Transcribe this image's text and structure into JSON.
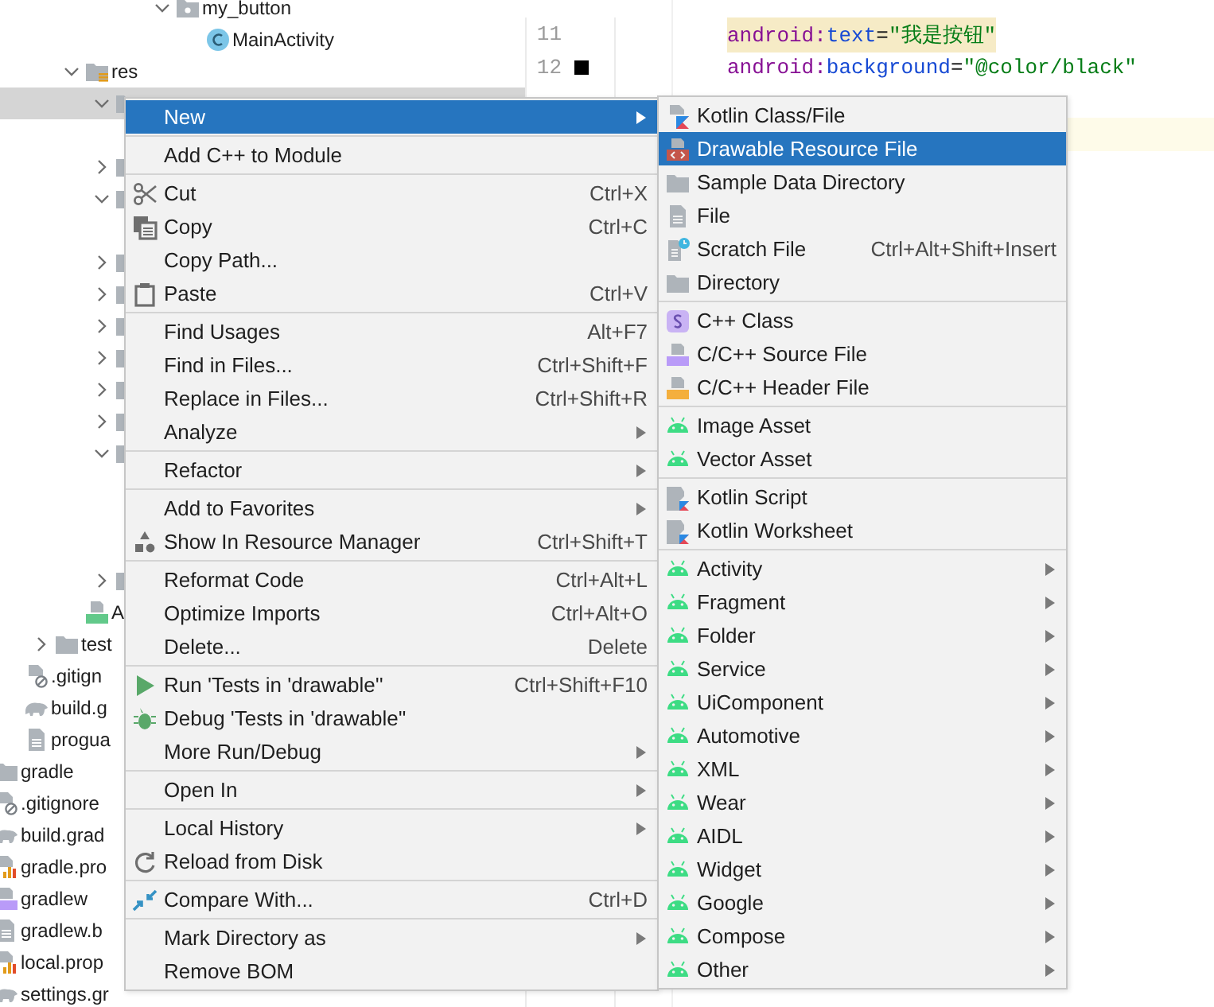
{
  "project_tree": [
    {
      "children": [
        {
          "children": [
            {
              "children": [
                {
                  "children": [
                    {
                      "children": [
                        {
                          "children": [
                            {
                              "label": "my_button",
                              "kind": "package",
                              "expanded": true,
                              "selected": false,
                              "children": [
                                {
                                  "label": "MainActivity",
                                  "kind": "class",
                                  "selected": false
                                }
                              ]
                            }
                          ]
                        }
                      ]
                    }
                  ]
                },
                {
                  "label": "res",
                  "kind": "res-folder",
                  "expanded": true,
                  "selected": false,
                  "children": [
                    {
                      "kind": "folder",
                      "expanded": true,
                      "selected": true,
                      "children": [
                        {
                          "selected": false
                        }
                      ]
                    },
                    {
                      "kind": "folder",
                      "expanded": false,
                      "selected": false
                    },
                    {
                      "kind": "folder",
                      "expanded": true,
                      "selected": false,
                      "children": [
                        {
                          "selected": false
                        }
                      ]
                    },
                    {
                      "kind": "folder",
                      "expanded": false,
                      "selected": false
                    },
                    {
                      "kind": "folder",
                      "expanded": false,
                      "selected": false
                    },
                    {
                      "kind": "folder",
                      "expanded": false,
                      "selected": false
                    },
                    {
                      "kind": "folder",
                      "expanded": false,
                      "selected": false
                    },
                    {
                      "kind": "folder",
                      "expanded": false,
                      "selected": false
                    },
                    {
                      "kind": "folder",
                      "expanded": false,
                      "selected": false
                    },
                    {
                      "kind": "folder",
                      "expanded": true,
                      "selected": false,
                      "children": [
                        {
                          "selected": false
                        },
                        {
                          "selected": false
                        },
                        {
                          "selected": false
                        }
                      ]
                    },
                    {
                      "kind": "folder",
                      "expanded": false,
                      "selected": false
                    }
                  ]
                },
                {
                  "label": "A",
                  "kind": "manifest",
                  "selected": false
                }
              ]
            },
            {
              "label": "test",
              "kind": "folder",
              "expanded": false,
              "selected": false
            }
          ]
        },
        {
          "label": ".gitign",
          "kind": "ignore",
          "selected": false
        },
        {
          "label": "build.g",
          "kind": "gradle",
          "selected": false
        },
        {
          "label": "progua",
          "kind": "text",
          "selected": false
        }
      ]
    },
    {
      "label": "gradle",
      "kind": "folder",
      "selected": false
    },
    {
      "label": ".gitignore",
      "kind": "ignore",
      "selected": false
    },
    {
      "label": "build.grad",
      "kind": "gradle",
      "selected": false
    },
    {
      "label": "gradle.pro",
      "kind": "properties",
      "selected": false
    },
    {
      "label": "gradlew",
      "kind": "script",
      "selected": false
    },
    {
      "label": "gradlew.b",
      "kind": "text",
      "selected": false
    },
    {
      "label": "local.prop",
      "kind": "properties",
      "selected": false
    },
    {
      "label": "settings.gr",
      "kind": "gradle",
      "selected": false
    }
  ],
  "editor": {
    "lines": [
      {
        "number": "11",
        "highlighted": true,
        "current": false,
        "tokens": [
          {
            "text": "android:",
            "kind": "namespace"
          },
          {
            "text": "text",
            "kind": "attribute"
          },
          {
            "text": "=",
            "kind": "plain"
          },
          {
            "text": "\"我是按钮\"",
            "kind": "value"
          }
        ]
      },
      {
        "number": "12",
        "color": "#000000",
        "highlighted": false,
        "current": false,
        "tokens": [
          {
            "text": "android:",
            "kind": "namespace"
          },
          {
            "text": "background",
            "kind": "attribute"
          },
          {
            "text": "=",
            "kind": "plain"
          },
          {
            "text": "\"@color/black\"",
            "kind": "value"
          }
        ]
      },
      {
        "current": false
      },
      {
        "current": true
      }
    ]
  },
  "context_menu": {
    "groups": [
      [
        {
          "label": "New",
          "submenu": true,
          "selected": true
        }
      ],
      [
        {
          "label": "Add C++ to Module",
          "submenu": false,
          "selected": false
        }
      ],
      [
        {
          "label": "Cut",
          "shortcut": "Ctrl+X",
          "kind": "scissors",
          "submenu": false,
          "selected": false
        },
        {
          "label": "Copy",
          "shortcut": "Ctrl+C",
          "kind": "copy",
          "submenu": false,
          "selected": false
        },
        {
          "label": "Copy Path...",
          "submenu": false,
          "selected": false
        },
        {
          "label": "Paste",
          "shortcut": "Ctrl+V",
          "kind": "clipboard",
          "submenu": false,
          "selected": false
        }
      ],
      [
        {
          "label": "Find Usages",
          "shortcut": "Alt+F7",
          "submenu": false,
          "selected": false
        },
        {
          "label": "Find in Files...",
          "shortcut": "Ctrl+Shift+F",
          "submenu": false,
          "selected": false
        },
        {
          "label": "Replace in Files...",
          "shortcut": "Ctrl+Shift+R",
          "submenu": false,
          "selected": false
        },
        {
          "label": "Analyze",
          "submenu": true,
          "selected": false
        }
      ],
      [
        {
          "label": "Refactor",
          "submenu": true,
          "selected": false
        }
      ],
      [
        {
          "label": "Add to Favorites",
          "submenu": true,
          "selected": false
        },
        {
          "label": "Show In Resource Manager",
          "shortcut": "Ctrl+Shift+T",
          "kind": "shapes",
          "submenu": false,
          "selected": false
        }
      ],
      [
        {
          "label": "Reformat Code",
          "shortcut": "Ctrl+Alt+L",
          "submenu": false,
          "selected": false
        },
        {
          "label": "Optimize Imports",
          "shortcut": "Ctrl+Alt+O",
          "submenu": false,
          "selected": false
        },
        {
          "label": "Delete...",
          "shortcut": "Delete",
          "submenu": false,
          "selected": false
        }
      ],
      [
        {
          "label": "Run 'Tests in 'drawable''",
          "shortcut": "Ctrl+Shift+F10",
          "kind": "run",
          "submenu": false,
          "selected": false
        },
        {
          "label": "Debug 'Tests in 'drawable''",
          "kind": "bug",
          "submenu": false,
          "selected": false
        },
        {
          "label": "More Run/Debug",
          "submenu": true,
          "selected": false
        }
      ],
      [
        {
          "label": "Open In",
          "submenu": true,
          "selected": false
        }
      ],
      [
        {
          "label": "Local History",
          "submenu": true,
          "selected": false
        },
        {
          "label": "Reload from Disk",
          "kind": "reload",
          "submenu": false,
          "selected": false
        }
      ],
      [
        {
          "label": "Compare With...",
          "shortcut": "Ctrl+D",
          "kind": "compare",
          "submenu": false,
          "selected": false
        }
      ],
      [
        {
          "label": "Mark Directory as",
          "submenu": true,
          "selected": false
        },
        {
          "label": "Remove BOM",
          "submenu": false,
          "selected": false
        }
      ]
    ]
  },
  "new_submenu": {
    "groups": [
      [
        {
          "label": "Kotlin Class/File",
          "kind": "kotlin-file",
          "submenu": false,
          "selected": false
        },
        {
          "label": "Drawable Resource File",
          "kind": "xml-file",
          "submenu": false,
          "selected": true
        },
        {
          "label": "Sample Data Directory",
          "kind": "folder",
          "submenu": false,
          "selected": false
        },
        {
          "label": "File",
          "kind": "file",
          "submenu": false,
          "selected": false
        },
        {
          "label": "Scratch File",
          "shortcut": "Ctrl+Alt+Shift+Insert",
          "kind": "scratch",
          "submenu": false,
          "selected": false
        },
        {
          "label": "Directory",
          "kind": "folder",
          "submenu": false,
          "selected": false
        }
      ],
      [
        {
          "label": "C++ Class",
          "kind": "cpp-class",
          "submenu": false,
          "selected": false
        },
        {
          "label": "C/C++ Source File",
          "kind": "cpp-source",
          "submenu": false,
          "selected": false
        },
        {
          "label": "C/C++ Header File",
          "kind": "cpp-header",
          "submenu": false,
          "selected": false
        }
      ],
      [
        {
          "label": "Image Asset",
          "kind": "android",
          "submenu": false,
          "selected": false
        },
        {
          "label": "Vector Asset",
          "kind": "android",
          "submenu": false,
          "selected": false
        }
      ],
      [
        {
          "label": "Kotlin Script",
          "kind": "kotlin-script",
          "submenu": false,
          "selected": false
        },
        {
          "label": "Kotlin Worksheet",
          "kind": "kotlin-script",
          "submenu": false,
          "selected": false
        }
      ],
      [
        {
          "label": "Activity",
          "kind": "android",
          "submenu": true,
          "selected": false
        },
        {
          "label": "Fragment",
          "kind": "android",
          "submenu": true,
          "selected": false
        },
        {
          "label": "Folder",
          "kind": "android",
          "submenu": true,
          "selected": false
        },
        {
          "label": "Service",
          "kind": "android",
          "submenu": true,
          "selected": false
        },
        {
          "label": "UiComponent",
          "kind": "android",
          "submenu": true,
          "selected": false
        },
        {
          "label": "Automotive",
          "kind": "android",
          "submenu": true,
          "selected": false
        },
        {
          "label": "XML",
          "kind": "android",
          "submenu": true,
          "selected": false
        },
        {
          "label": "Wear",
          "kind": "android",
          "submenu": true,
          "selected": false
        },
        {
          "label": "AIDL",
          "kind": "android",
          "submenu": true,
          "selected": false
        },
        {
          "label": "Widget",
          "kind": "android",
          "submenu": true,
          "selected": false
        },
        {
          "label": "Google",
          "kind": "android",
          "submenu": true,
          "selected": false
        },
        {
          "label": "Compose",
          "kind": "android",
          "submenu": true,
          "selected": false
        },
        {
          "label": "Other",
          "kind": "android",
          "submenu": true,
          "selected": false
        }
      ]
    ]
  }
}
